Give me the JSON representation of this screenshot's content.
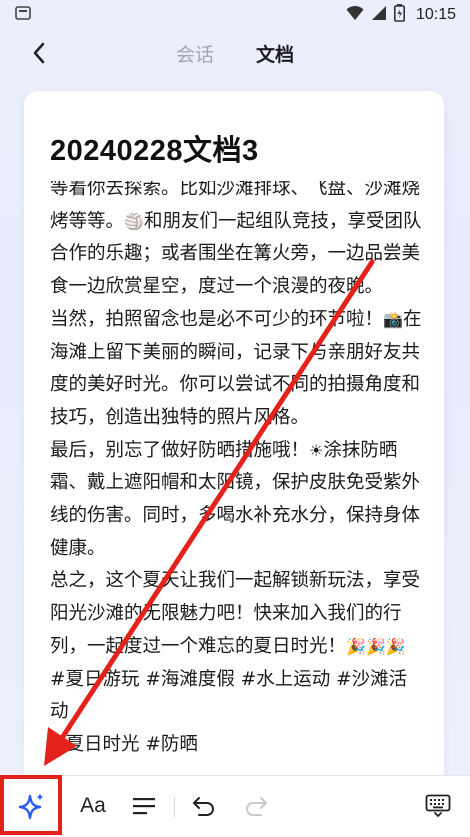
{
  "status_bar": {
    "time": "10:15",
    "icons": [
      "notification-icon",
      "wifi-icon",
      "signal-icon",
      "battery-icon"
    ]
  },
  "header": {
    "tabs": [
      {
        "label": "会话",
        "active": false
      },
      {
        "label": "文档",
        "active": true
      }
    ]
  },
  "document": {
    "title": "20240228文档3",
    "paragraphs": [
      "等着你去探索。比如沙滩排球、飞盘、沙滩烧烤等等。",
      "和朋友们一起组队竞技，享受团队合作的乐趣；或者围坐在篝火旁，一边品尝美食一边欣赏星空，度过一个浪漫的夜晚。",
      "当然，拍照留念也是必不可少的环节啦！",
      "在海滩上留下美丽的瞬间，记录下与亲朋好友共度的美好时光。你可以尝试不同的拍摄角度和技巧，创造出独特的照片风格。",
      "最后，别忘了做好防晒措施哦！",
      "涂抹防晒霜、戴上遮阳帽和太阳镜，保护皮肤免受紫外线的伤害。同时，多喝水补充水分，保持身体健康。",
      "总之，这个夏天让我们一起解锁新玩法，享受阳光沙滩的无限魅力吧！快来加入我们的行列，一起度过一个难忘的夏日时光！",
      "#夏日游玩 #海滩度假 #水上运动 #沙滩活动",
      "#夏日时光 #防晒"
    ]
  },
  "toolbar": {
    "font_label": "Aa"
  },
  "colors": {
    "annotation_red": "#e3231b",
    "ai_blue": "#2a5cf0"
  }
}
